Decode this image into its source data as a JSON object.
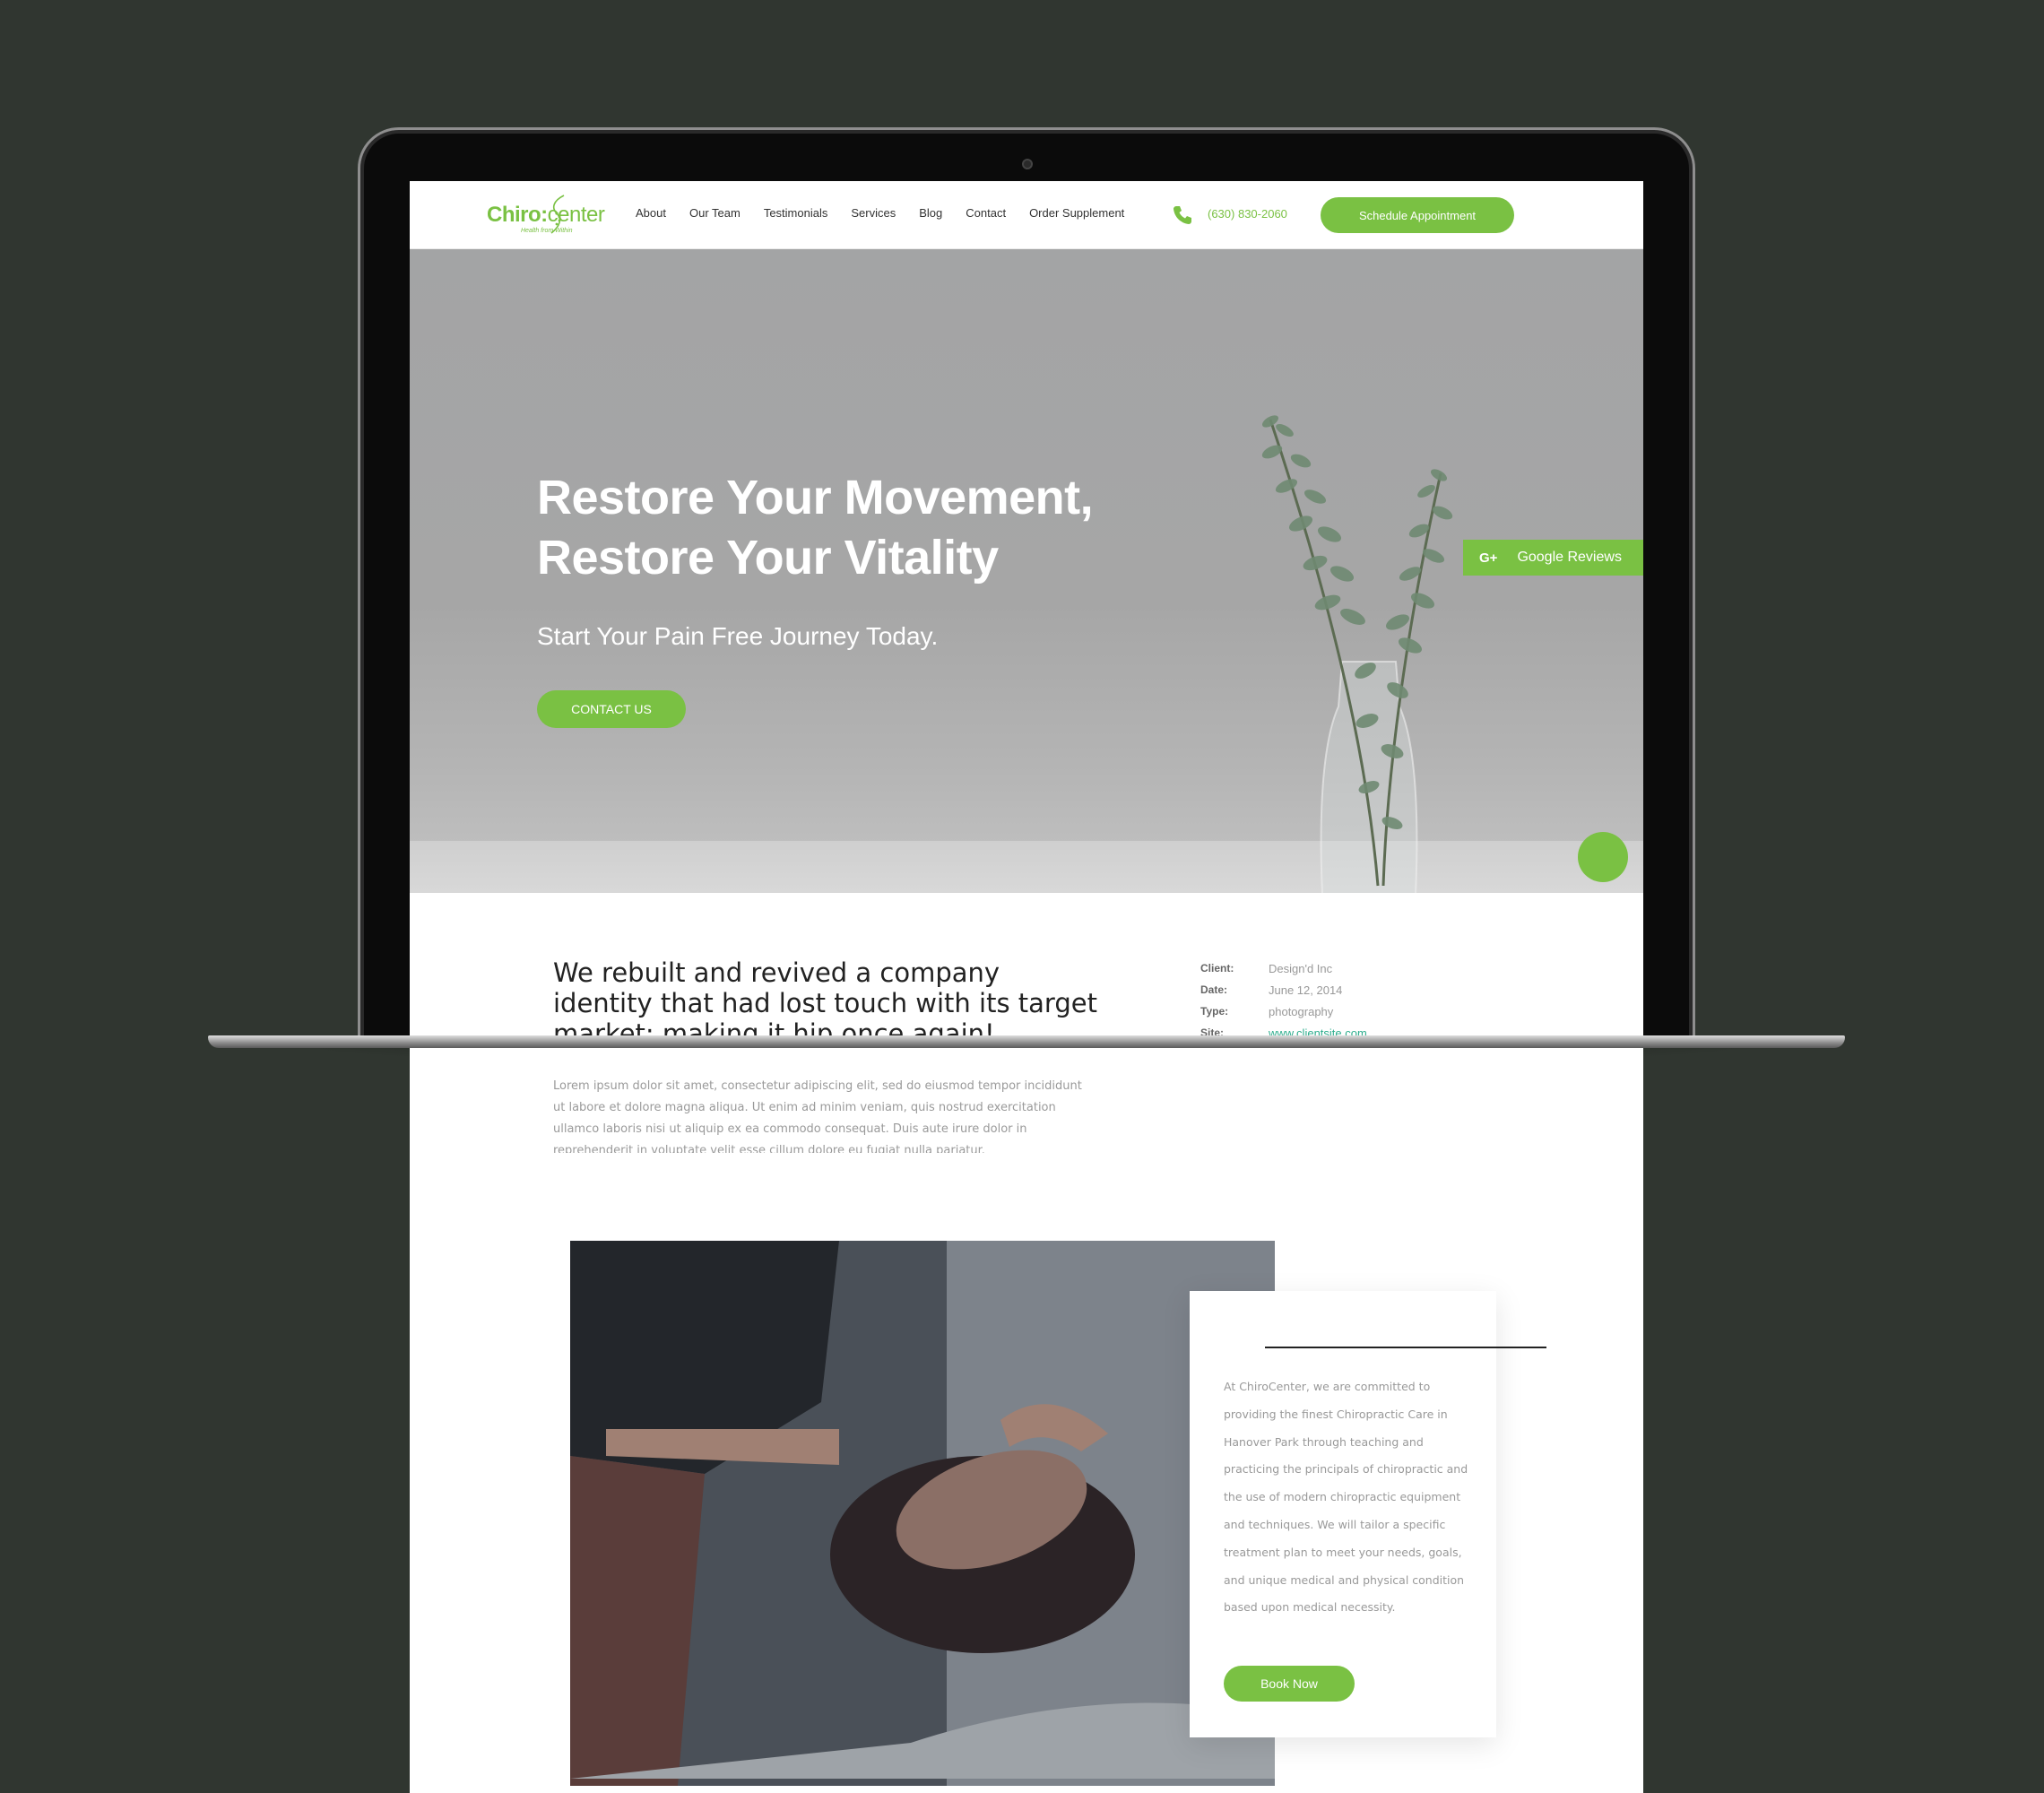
{
  "brand": {
    "logo_text_a": "Chiro",
    "logo_text_b": "center",
    "logo_tagline": "Health from Within",
    "accent": "#7ac143",
    "link_color": "#2fae8e"
  },
  "nav": {
    "items": [
      "About",
      "Our Team",
      "Testimonials",
      "Services",
      "Blog",
      "Contact",
      "Order Supplement"
    ],
    "phone": "(630) 830-2060",
    "schedule_label": "Schedule Appointment"
  },
  "hero": {
    "title_line1": "Restore Your Movement,",
    "title_line2": "Restore Your Vitality",
    "subtitle": "Start Your Pain Free Journey Today.",
    "cta": "CONTACT US",
    "reviews_icon": "G+",
    "reviews_label": "Google Reviews"
  },
  "project": {
    "headline": "We rebuilt and revived a company identity that had lost touch with its target market; making it hip once again!",
    "body": "Lorem ipsum dolor sit amet, consectetur adipiscing elit, sed do eiusmod tempor incididunt ut labore et dolore magna aliqua. Ut enim ad minim veniam, quis nostrud exercitation ullamco laboris nisi ut aliquip ex ea commodo consequat. Duis aute irure dolor in reprehenderit in voluptate velit esse cillum dolore eu fugiat nulla pariatur.",
    "meta": [
      {
        "key": "Client:",
        "value": "Design'd Inc"
      },
      {
        "key": "Date:",
        "value": "June 12, 2014"
      },
      {
        "key": "Type:",
        "value": "photography"
      },
      {
        "key": "Site:",
        "value": "www.clientsite.com"
      }
    ]
  },
  "about_card": {
    "text": "At ChiroCenter, we are committed to providing the finest Chiropractic Care in Hanover Park through teaching and practicing the principals of chiropractic and the use of modern chiropractic equipment and techniques. We will tailor a specific treatment plan to meet your needs, goals, and unique medical and physical condition based upon medical necessity.",
    "button": "Book Now"
  }
}
